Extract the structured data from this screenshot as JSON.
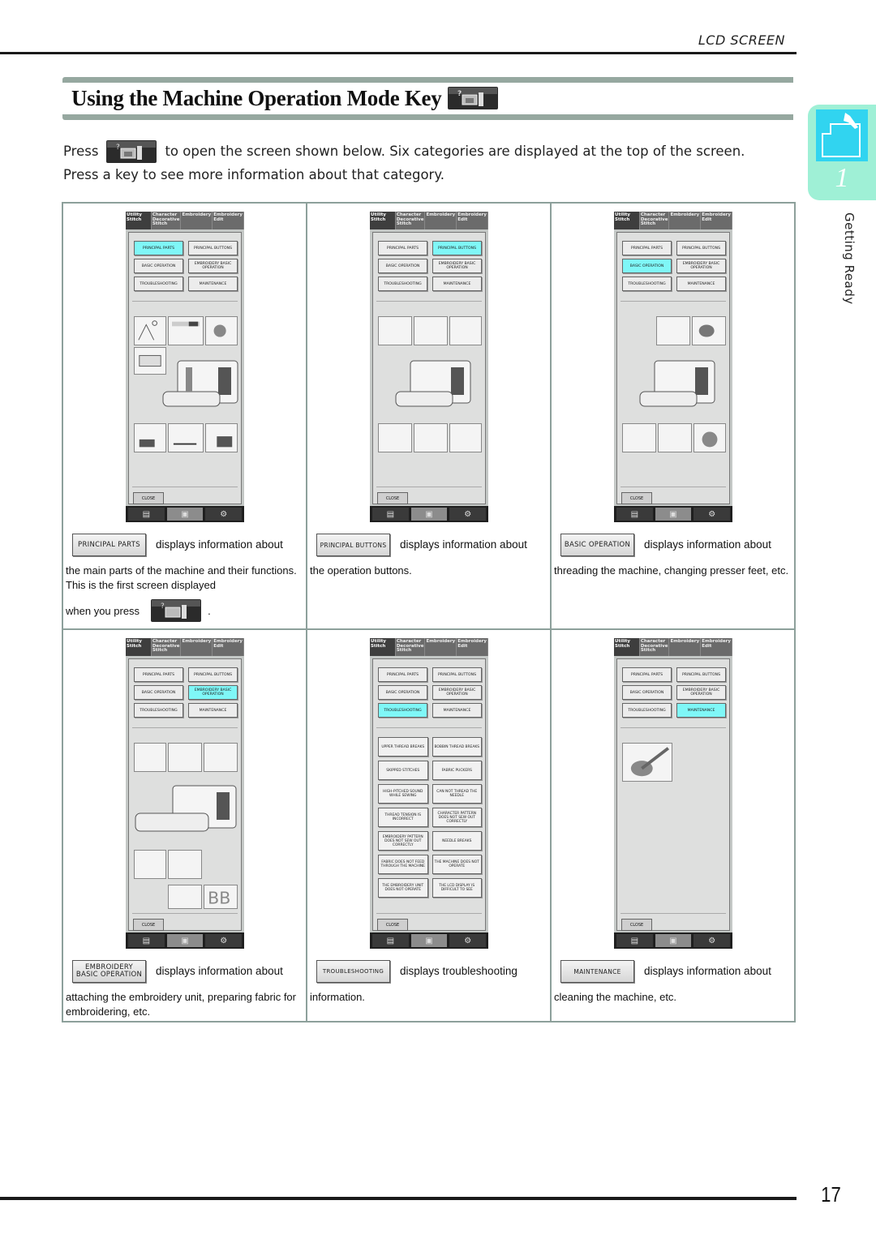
{
  "header": {
    "section_label": "LCD SCREEN"
  },
  "title": {
    "text": "Using the Machine Operation Mode Key",
    "key_icon": "machine-operation-mode-key-icon"
  },
  "intro": {
    "press_label": "Press",
    "line1_rest": "to open the screen shown below. Six categories are displayed at the top of the screen.",
    "line2": "Press a key to see more information about that category."
  },
  "side_tab": {
    "chapter_number": "1",
    "chapter_label": "Getting Ready",
    "icon": "sewing-machine-hand-icon",
    "color": "#9ff0d6",
    "icon_color": "#31d4f0"
  },
  "lcd": {
    "tabs": [
      "Utility Stitch",
      "Character Decorative Stitch",
      "Embroidery",
      "Embroidery Edit"
    ],
    "buttons": [
      "PRINCIPAL PARTS",
      "PRINCIPAL BUTTONS",
      "BASIC OPERATION",
      "EMBROIDERY BASIC OPERATION",
      "TROUBLESHOOTING",
      "MAINTENANCE"
    ],
    "close_label": "CLOSE",
    "footer_icons": [
      "sewing-guide-icon",
      "machine-operation-mode-icon",
      "settings-icon"
    ],
    "highlight_color": "#7ff7f7",
    "troubleshooting_items": [
      "UPPER THREAD BREAKS",
      "BOBBIN THREAD BREAKS",
      "SKIPPED STITCHES",
      "FABRIC PUCKERS",
      "HIGH-PITCHED SOUND WHILE SEWING",
      "CAN NOT THREAD THE NEEDLE",
      "THREAD TENSION IS INCORRECT",
      "CHARACTER PATTERN DOES NOT SEW OUT CORRECTLY",
      "EMBROIDERY PATTERN DOES NOT SEW OUT CORRECTLY",
      "NEEDLE BREAKS",
      "FABRIC DOES NOT FEED THROUGH THE MACHINE",
      "THE MACHINE DOES NOT OPERATE",
      "THE EMBROIDERY UNIT DOES NOT OPERATE",
      "THE LCD DISPLAY IS DIFFICULT TO SEE"
    ]
  },
  "cells": [
    {
      "key_label": "PRINCIPAL PARTS",
      "active_index": 0,
      "inline": "displays information about",
      "body": "the main parts of the machine and their functions. This is the first screen displayed",
      "press_text": "when you press",
      "press_end": "."
    },
    {
      "key_label": "PRINCIPAL BUTTONS",
      "active_index": 1,
      "inline": "displays information about",
      "body": "the operation buttons."
    },
    {
      "key_label": "BASIC OPERATION",
      "active_index": 2,
      "inline": "displays information about",
      "body": "threading the machine, changing presser feet, etc."
    },
    {
      "key_label": "EMBROIDERY BASIC OPERATION",
      "key_line1": "EMBROIDERY",
      "key_line2": "BASIC OPERATION",
      "active_index": 3,
      "inline": "displays information about",
      "body": "attaching the embroidery unit, preparing fabric for embroidering, etc."
    },
    {
      "key_label": "TROUBLESHOOTING",
      "active_index": 4,
      "inline": "displays troubleshooting",
      "body": "information."
    },
    {
      "key_label": "MAINTENANCE",
      "active_index": 5,
      "inline": "displays information about",
      "body": "cleaning the machine, etc."
    }
  ],
  "footer": {
    "page_number": "17"
  }
}
